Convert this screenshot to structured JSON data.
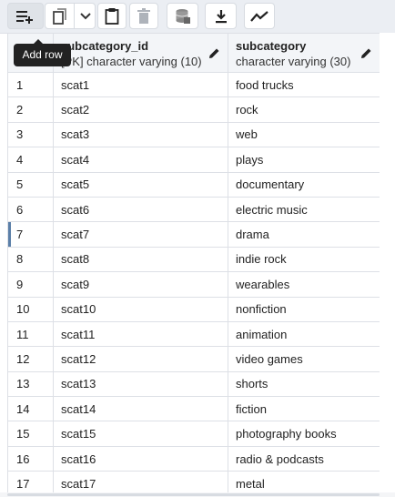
{
  "toolbar": {
    "buttons": [
      {
        "name": "add-row-button",
        "icon": "add-row-icon"
      },
      {
        "name": "copy-button",
        "icon": "copy-icon"
      },
      {
        "name": "copy-options-dropdown",
        "icon": "chevron-down-icon"
      },
      {
        "name": "paste-button",
        "icon": "paste-icon"
      },
      {
        "name": "delete-button",
        "icon": "trash-icon"
      },
      {
        "name": "save-data-button",
        "icon": "database-save-icon"
      },
      {
        "name": "download-button",
        "icon": "download-icon"
      },
      {
        "name": "graph-button",
        "icon": "line-chart-icon"
      }
    ],
    "tooltip": "Add row"
  },
  "grid": {
    "columns": [
      {
        "name": "subcategory_id",
        "type": "[PK] character varying (10)"
      },
      {
        "name": "subcategory",
        "type": "character varying (30)"
      }
    ],
    "rows": [
      {
        "n": "1",
        "id": "scat1",
        "sub": "food trucks"
      },
      {
        "n": "2",
        "id": "scat2",
        "sub": "rock"
      },
      {
        "n": "3",
        "id": "scat3",
        "sub": "web"
      },
      {
        "n": "4",
        "id": "scat4",
        "sub": "plays"
      },
      {
        "n": "5",
        "id": "scat5",
        "sub": "documentary"
      },
      {
        "n": "6",
        "id": "scat6",
        "sub": "electric music"
      },
      {
        "n": "7",
        "id": "scat7",
        "sub": "drama"
      },
      {
        "n": "8",
        "id": "scat8",
        "sub": "indie rock"
      },
      {
        "n": "9",
        "id": "scat9",
        "sub": "wearables"
      },
      {
        "n": "10",
        "id": "scat10",
        "sub": "nonfiction"
      },
      {
        "n": "11",
        "id": "scat11",
        "sub": "animation"
      },
      {
        "n": "12",
        "id": "scat12",
        "sub": "video games"
      },
      {
        "n": "13",
        "id": "scat13",
        "sub": "shorts"
      },
      {
        "n": "14",
        "id": "scat14",
        "sub": "fiction"
      },
      {
        "n": "15",
        "id": "scat15",
        "sub": "photography books"
      },
      {
        "n": "16",
        "id": "scat16",
        "sub": "radio & podcasts"
      },
      {
        "n": "17",
        "id": "scat17",
        "sub": "metal"
      }
    ],
    "selected_row": "7"
  },
  "colors": {
    "toolbar_bg": "#ebeef3",
    "header_bg": "#f3f5f8",
    "border": "#dde0e6",
    "selection_marker": "#5b7fa8",
    "tooltip_bg": "#222222"
  }
}
